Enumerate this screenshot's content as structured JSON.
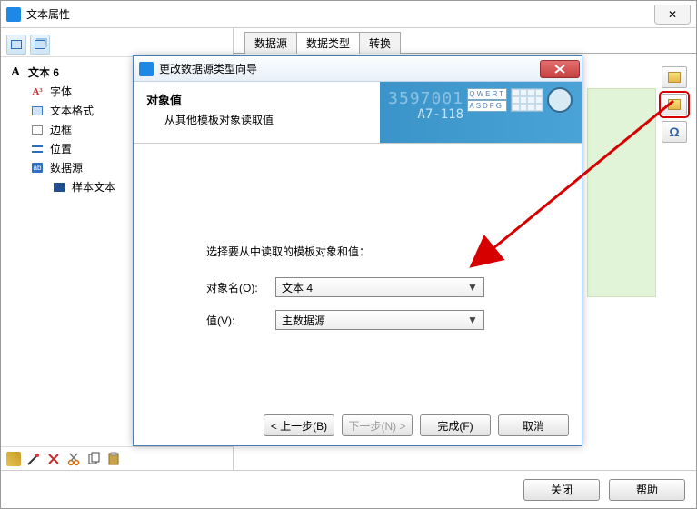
{
  "outerWindow": {
    "title": "文本属性",
    "closeGlyph": "✕"
  },
  "tree": {
    "root": "文本 6",
    "items": [
      {
        "label": "字体"
      },
      {
        "label": "文本格式"
      },
      {
        "label": "边框"
      },
      {
        "label": "位置"
      },
      {
        "label": "数据源",
        "children": [
          {
            "label": "样本文本"
          }
        ]
      }
    ]
  },
  "tabs": {
    "items": [
      {
        "label": "数据源",
        "active": false
      },
      {
        "label": "数据类型",
        "active": true
      },
      {
        "label": "转换",
        "active": false
      }
    ]
  },
  "dialog": {
    "title": "更改数据源类型向导",
    "banner": {
      "title": "对象值",
      "sub": "从其他模板对象读取值",
      "decoNum": "3597001",
      "decoA7": "A7-118",
      "kbd1": "QWERT",
      "kbd2": "ASDFG"
    },
    "instruction": "选择要从中读取的模板对象和值：",
    "objectLabel": "对象名(O):",
    "objectValue": "文本 4",
    "valueLabel": "值(V):",
    "valueValue": "主数据源",
    "buttons": {
      "back": "< 上一步(B)",
      "next": "下一步(N) >",
      "finish": "完成(F)",
      "cancel": "取消"
    }
  },
  "footer": {
    "close": "关闭",
    "help": "帮助"
  },
  "sideIcons": {
    "omega": "Ω"
  }
}
